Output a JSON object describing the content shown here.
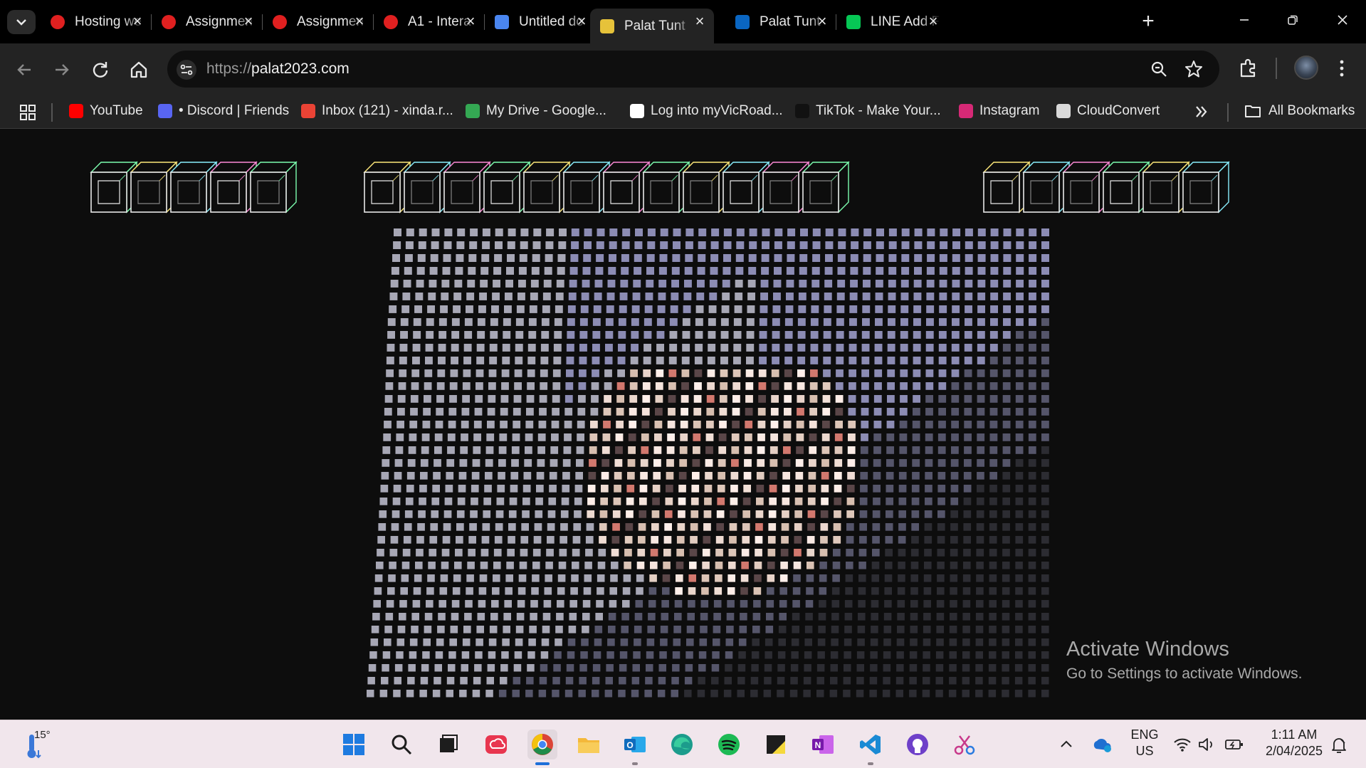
{
  "tabs": [
    {
      "title": "Hosting we",
      "favicon_color": "#e02020",
      "active": false
    },
    {
      "title": "Assignmen",
      "favicon_color": "#e02020",
      "active": false
    },
    {
      "title": "Assignmen",
      "favicon_color": "#e02020",
      "active": false
    },
    {
      "title": "A1 - Intera",
      "favicon_color": "#e02020",
      "active": false
    },
    {
      "title": "Untitled do",
      "favicon_color": "#4a86f0",
      "active": false
    },
    {
      "title": "Palat Tunt",
      "favicon_color": "#e6c23a",
      "active": true
    },
    {
      "title": "Palat Tunt",
      "favicon_color": "#0a66c2",
      "active": false
    },
    {
      "title": "LINE Add F",
      "favicon_color": "#06c755",
      "active": false
    }
  ],
  "toolbar": {
    "url_scheme": "https://",
    "url_host": "palat2023.com"
  },
  "bookmarks": [
    {
      "label": "YouTube",
      "icon_color": "#ff0000"
    },
    {
      "label": "• Discord | Friends",
      "icon_color": "#5865f2"
    },
    {
      "label": "Inbox (121) - xinda.r...",
      "icon_color": "#ea4335"
    },
    {
      "label": "My Drive - Google...",
      "icon_color": "#34a853"
    },
    {
      "label": "Log into myVicRoad...",
      "icon_color": "#ffffff"
    },
    {
      "label": "TikTok - Make Your...",
      "icon_color": "#111111"
    },
    {
      "label": "Instagram",
      "icon_color": "#d62976"
    },
    {
      "label": "CloudConvert",
      "icon_color": "#d9d9d9"
    }
  ],
  "bookmarks_all_label": "All Bookmarks",
  "page": {
    "heading_art": "PIXEL DISPLACEMENT EFFECT",
    "accent_colors": [
      "#7dffb0",
      "#ffe97a",
      "#8af0ff",
      "#ff8ad8"
    ],
    "grid_dark": "#2c2c32",
    "grid_light": "#a7a7b5",
    "grid_lavender": "#8c8cb4"
  },
  "watermark": {
    "line1": "Activate Windows",
    "line2": "Go to Settings to activate Windows."
  },
  "taskbar": {
    "weather_temp": "15°",
    "apps": [
      "windows-start",
      "search",
      "task-view",
      "creative-cloud",
      "chrome",
      "file-explorer",
      "outlook",
      "edge",
      "spotify",
      "sticky-notes",
      "onenote",
      "vscode",
      "github-desktop",
      "snipping-tool"
    ],
    "lang_line1": "ENG",
    "lang_line2": "US",
    "time": "1:11 AM",
    "date": "2/04/2025"
  }
}
